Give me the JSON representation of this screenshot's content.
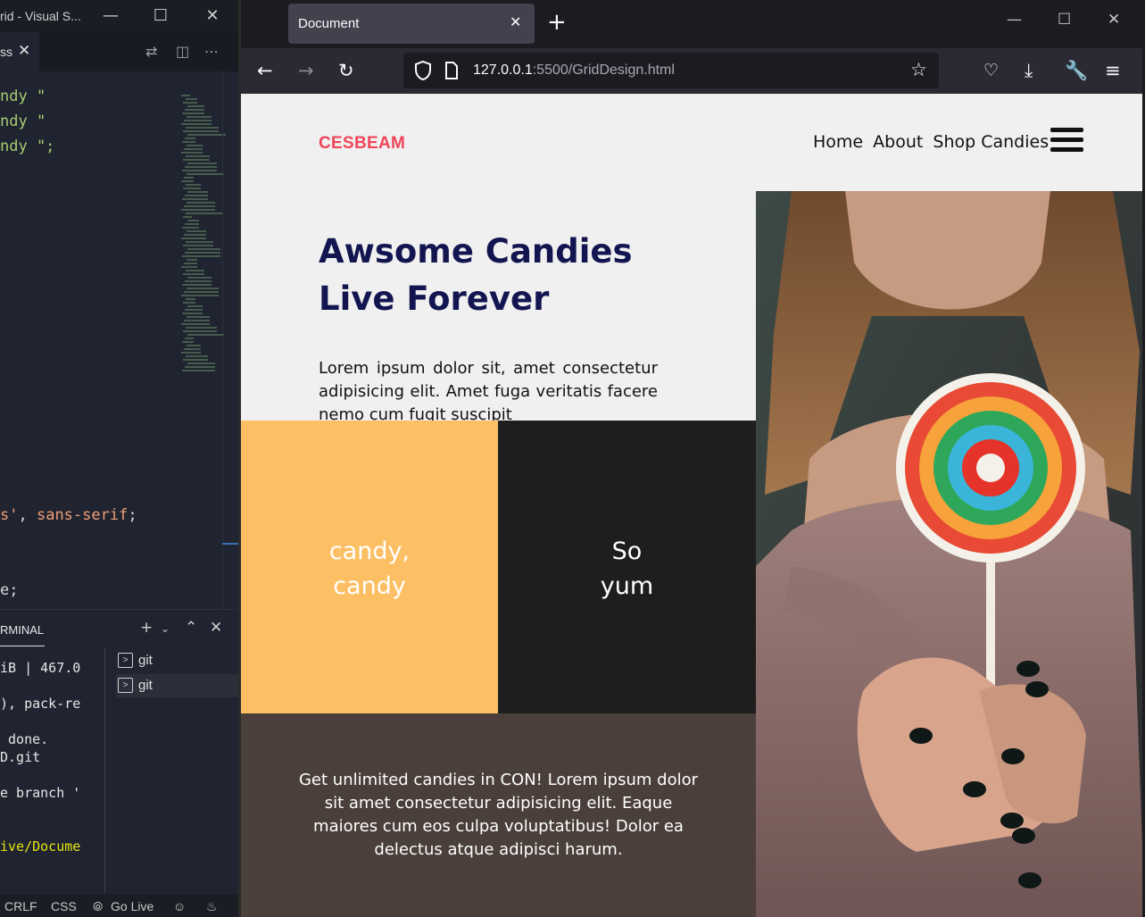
{
  "vscode": {
    "window_title": "rid - Visual S...",
    "tab_label": "ss",
    "code_lines": [
      {
        "text": "ndy \"",
        "color": "#a6cc70"
      },
      {
        "text": "ndy \"",
        "color": "#a6cc70"
      },
      {
        "text": "ndy \";",
        "color": "#a6cc70"
      }
    ],
    "code_font_line": {
      "a": "s'",
      "b": ", ",
      "c": "sans-serif",
      "d": ";"
    },
    "code_last_line": "e;",
    "panel_title": "RMINAL",
    "terminal_lines": [
      {
        "text": "iB | 467.0",
        "color": "#e6e6e6"
      },
      {
        "text": "), pack-re",
        "color": "#e6e6e6"
      },
      {
        "text": " done.",
        "color": "#e6e6e6"
      },
      {
        "text": "D.git",
        "color": "#e6e6e6"
      },
      {
        "text": "e branch '",
        "color": "#e6e6e6"
      },
      {
        "text": "ive/Docume",
        "color": "#e5e510"
      }
    ],
    "terminals": [
      {
        "label": "git",
        "selected": false
      },
      {
        "label": "git",
        "selected": true
      }
    ],
    "status": {
      "eol": "CRLF",
      "lang": "CSS",
      "golive": "Go Live"
    }
  },
  "browser": {
    "tab_title": "Document",
    "url_host": "127.0.0.1",
    "url_rest": ":5500/GridDesign.html"
  },
  "site": {
    "brand": "CESBEAM",
    "nav": [
      "Home",
      "About",
      "Shop Candies"
    ],
    "hero_title_line1": "Awsome Candies",
    "hero_title_line2": "Live Forever",
    "hero_body": "Lorem ipsum dolor sit, amet consectetur adipisicing elit. Amet fuga veritatis facere nemo cum fugit suscipit",
    "tile_yellow_line1": "candy,",
    "tile_yellow_line2": "candy",
    "tile_dark_line1": "So",
    "tile_dark_line2": "yum",
    "footer_text": "Get unlimited candies in CON! Lorem ipsum dolor sit amet consectetur adipisicing elit. Eaque maiores cum eos culpa voluptatibus! Dolor ea delectus atque adipisci harum."
  },
  "colors": {
    "brand": "#f0455a",
    "hero_title": "#131550",
    "tile_yellow": "#fdbf64",
    "tile_dark": "#1e1e1e",
    "tile_brown": "#4a3f3a"
  },
  "icons": {
    "back": "arrow-left-icon",
    "forward": "arrow-right-icon",
    "reload": "reload-icon",
    "bookmark": "star-icon",
    "pocket": "pocket-icon",
    "downloads": "download-icon",
    "tools": "wrench-icon",
    "menu": "hamburger-icon"
  }
}
